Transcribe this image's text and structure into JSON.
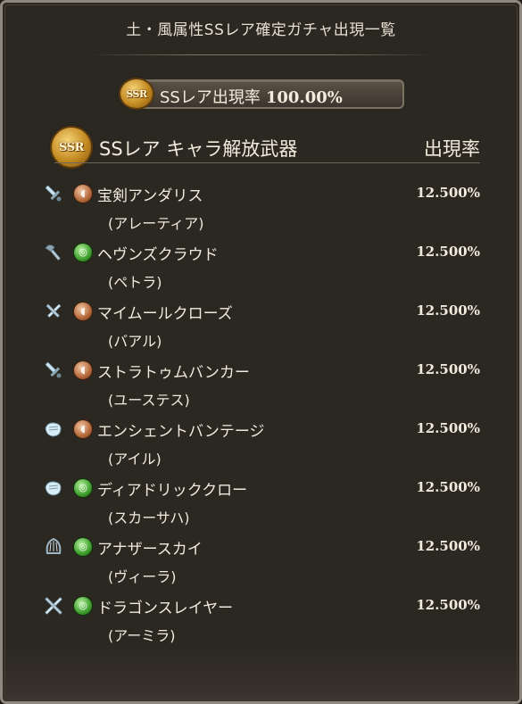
{
  "header": {
    "title": "土・風属性SSレア確定ガチャ出現一覧"
  },
  "summary": {
    "badge_text": "SSR",
    "label": "SSレア出現率",
    "rate": "100.00%"
  },
  "section": {
    "badge_text": "SSR",
    "title": "SSレア キャラ解放武器",
    "rate_label": "出現率"
  },
  "colors": {
    "earth": "#b5683c",
    "wind": "#3e9e2c",
    "gold": "#c48a22"
  },
  "items": [
    {
      "weapon_icon": "sword-icon",
      "element": "earth",
      "name": "宝剣アンダリス",
      "character": "(アレーティア)",
      "rate": "12.500%"
    },
    {
      "weapon_icon": "axe-icon",
      "element": "wind",
      "name": "ヘヴンズクラウド",
      "character": "(ペトラ)",
      "rate": "12.500%"
    },
    {
      "weapon_icon": "dagger-icon",
      "element": "earth",
      "name": "マイムールクローズ",
      "character": "(バアル)",
      "rate": "12.500%"
    },
    {
      "weapon_icon": "sword-icon",
      "element": "earth",
      "name": "ストラトゥムバンカー",
      "character": "(ユーステス)",
      "rate": "12.500%"
    },
    {
      "weapon_icon": "fist-icon",
      "element": "earth",
      "name": "エンシェントバンテージ",
      "character": "(アイル)",
      "rate": "12.500%"
    },
    {
      "weapon_icon": "fist-icon",
      "element": "wind",
      "name": "ディアドリッククロー",
      "character": "(スカーサハ)",
      "rate": "12.500%"
    },
    {
      "weapon_icon": "harp-icon",
      "element": "wind",
      "name": "アナザースカイ",
      "character": "(ヴィーラ)",
      "rate": "12.500%"
    },
    {
      "weapon_icon": "crossed-swords-icon",
      "element": "wind",
      "name": "ドラゴンスレイヤー",
      "character": "(アーミラ)",
      "rate": "12.500%"
    }
  ]
}
